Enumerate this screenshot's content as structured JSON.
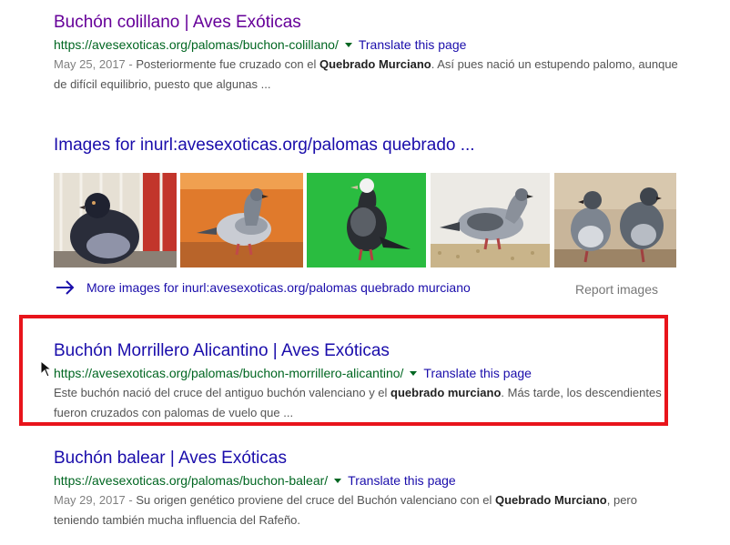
{
  "results": [
    {
      "title": "Buchón colillano | Aves Exóticas",
      "url": "https://avesexoticas.org/palomas/buchon-colillano/",
      "translate": "Translate this page",
      "date": "May 25, 2017",
      "sep": " - ",
      "s1": "Posteriormente fue cruzado con el ",
      "b1": "Quebrado Murciano",
      "s2": ". Así pues nació un estupendo palomo, aunque de difícil equilibrio, puesto que algunas ..."
    },
    {
      "title": "Buchón Morrillero Alicantino | Aves Exóticas",
      "url": "https://avesexoticas.org/palomas/buchon-morrillero-alicantino/",
      "translate": "Translate this page",
      "s1": "Este buchón nació del cruce del antiguo buchón valenciano y el ",
      "b1": "quebrado murciano",
      "s2": ". Más tarde, los descendientes fueron cruzados con palomas de vuelo que ..."
    },
    {
      "title": "Buchón balear | Aves Exóticas",
      "url": "https://avesexoticas.org/palomas/buchon-balear/",
      "translate": "Translate this page",
      "date": "May 29, 2017",
      "sep": " - ",
      "s1": "Su origen genético proviene del cruce del Buchón valenciano con el ",
      "b1": "Quebrado Murciano",
      "s2": ", pero teniendo también mucha influencia del Rafeño."
    }
  ],
  "images": {
    "header": "Images for inurl:avesexoticas.org/palomas quebrado ...",
    "more_link": "More images for inurl:avesexoticas.org/palomas quebrado murciano",
    "report": "Report images"
  },
  "colors": {
    "link": "#1a0dab",
    "visited": "#660099",
    "url": "#006621",
    "snippet": "#545454",
    "highlight": "#e8141b"
  },
  "icons": [
    "caret-down-icon",
    "arrow-right-icon",
    "mouse-pointer-icon"
  ]
}
